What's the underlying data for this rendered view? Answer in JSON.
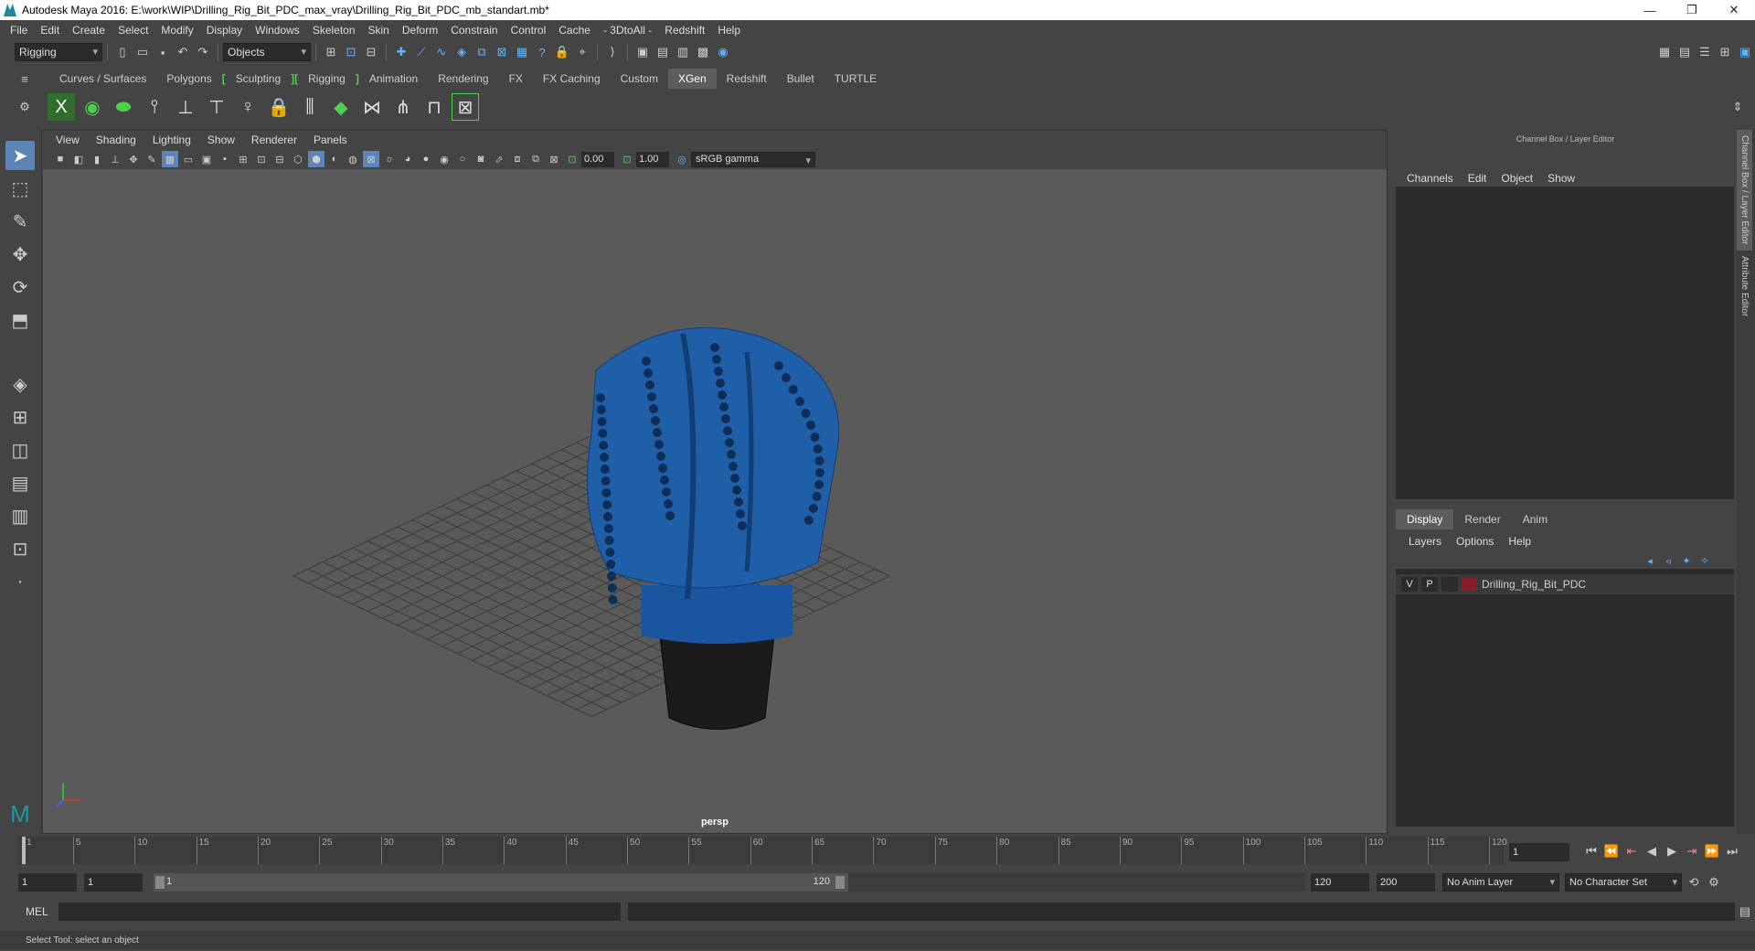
{
  "window": {
    "title": "Autodesk Maya 2016: E:\\work\\WIP\\Drilling_Rig_Bit_PDC_max_vray\\Drilling_Rig_Bit_PDC_mb_standart.mb*",
    "minimize": "—",
    "maximize": "❐",
    "close": "✕"
  },
  "menubar": [
    "File",
    "Edit",
    "Create",
    "Select",
    "Modify",
    "Display",
    "Windows",
    "Skeleton",
    "Skin",
    "Deform",
    "Constrain",
    "Control",
    "Cache",
    "- 3DtoAll -",
    "Redshift",
    "Help"
  ],
  "statusline": {
    "menu_set": "Rigging",
    "selection_mode": "Objects"
  },
  "shelf_tabs": [
    "Curves / Surfaces",
    "Polygons",
    "Sculpting",
    "Rigging",
    "Animation",
    "Rendering",
    "FX",
    "FX Caching",
    "Custom",
    "XGen",
    "Redshift",
    "Bullet",
    "TURTLE"
  ],
  "shelf_active_tab": "XGen",
  "viewport": {
    "menu": [
      "View",
      "Shading",
      "Lighting",
      "Show",
      "Renderer",
      "Panels"
    ],
    "exposure": "0.00",
    "gamma": "1.00",
    "color_space": "sRGB gamma",
    "camera_label": "persp"
  },
  "channel_box": {
    "title": "Channel Box / Layer Editor",
    "menu": [
      "Channels",
      "Edit",
      "Object",
      "Show"
    ]
  },
  "layer_editor": {
    "tabs": [
      "Display",
      "Render",
      "Anim"
    ],
    "active_tab": "Display",
    "menu": [
      "Layers",
      "Options",
      "Help"
    ],
    "layers": [
      {
        "visible": "V",
        "playback": "P",
        "name": "Drilling_Rig_Bit_PDC",
        "color": "#8b1a2b"
      }
    ]
  },
  "side_tabs": [
    "Channel Box / Layer Editor",
    "Attribute Editor"
  ],
  "time_slider": {
    "ticks": [
      "1",
      "5",
      "10",
      "15",
      "20",
      "25",
      "30",
      "35",
      "40",
      "45",
      "50",
      "55",
      "60",
      "65",
      "70",
      "75",
      "80",
      "85",
      "90",
      "95",
      "100",
      "105",
      "110",
      "115",
      "120"
    ],
    "current_frame": "1"
  },
  "range_slider": {
    "start": "1",
    "playback_start": "1",
    "range_start_label": "1",
    "range_end_label": "120",
    "playback_end": "120",
    "end": "200",
    "anim_layer": "No Anim Layer",
    "character_set": "No Character Set"
  },
  "command_line": {
    "label": "MEL"
  },
  "help_line": "Select Tool: select an object",
  "colors": {
    "accent_blue": "#5c84b4",
    "model_blue": "#1f5fa8",
    "shelf_bracket": "#4cd04c"
  }
}
